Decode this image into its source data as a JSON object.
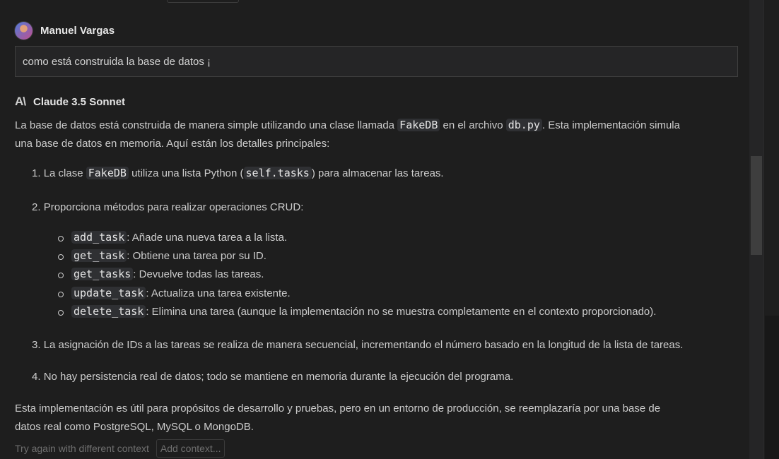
{
  "user": {
    "name": "Manuel Vargas",
    "message": "como está construida la base de datos ¡"
  },
  "model": {
    "name": "Claude 3.5 Sonnet",
    "icon": "anthropic-logo-icon",
    "icon_glyph": "A\\"
  },
  "response": {
    "intro_1": "La base de datos está construida de manera simple utilizando una clase llamada ",
    "intro_code_1": "FakeDB",
    "intro_2": " en el archivo ",
    "intro_code_2": "db.py",
    "intro_3": ". Esta implementación simula",
    "intro_line2": "una base de datos en memoria. Aquí están los detalles principales:",
    "item1": {
      "num": "1.",
      "a": "La clase ",
      "code1": "FakeDB",
      "b": " utiliza una lista Python (",
      "code2": "self.tasks",
      "c": ") para almacenar las tareas."
    },
    "item2": {
      "num": "2.",
      "text": "Proporciona métodos para realizar operaciones CRUD:"
    },
    "methods": [
      {
        "code": "add_task",
        "desc": ": Añade una nueva tarea a la lista."
      },
      {
        "code": "get_task",
        "desc": ": Obtiene una tarea por su ID."
      },
      {
        "code": "get_tasks",
        "desc": ": Devuelve todas las tareas."
      },
      {
        "code": "update_task",
        "desc": ": Actualiza una tarea existente."
      },
      {
        "code": "delete_task",
        "desc": ": Elimina una tarea (aunque la implementación no se muestra completamente en el contexto proporcionado)."
      }
    ],
    "item3": {
      "num": "3.",
      "text": "La asignación de IDs a las tareas se realiza de manera secuencial, incrementando el número basado en la longitud de la lista de tareas."
    },
    "item4": {
      "num": "4.",
      "text": "No hay persistencia real de datos; todo se mantiene en memoria durante la ejecución del programa."
    },
    "closing_1": "Esta implementación es útil para propósitos de desarrollo y pruebas, pero en un entorno de producción, se reemplazaría por una base de",
    "closing_2": "datos real como PostgreSQL, MySQL o MongoDB."
  },
  "footer": {
    "try_again": "Try again with different context",
    "add_context": "Add context..."
  }
}
